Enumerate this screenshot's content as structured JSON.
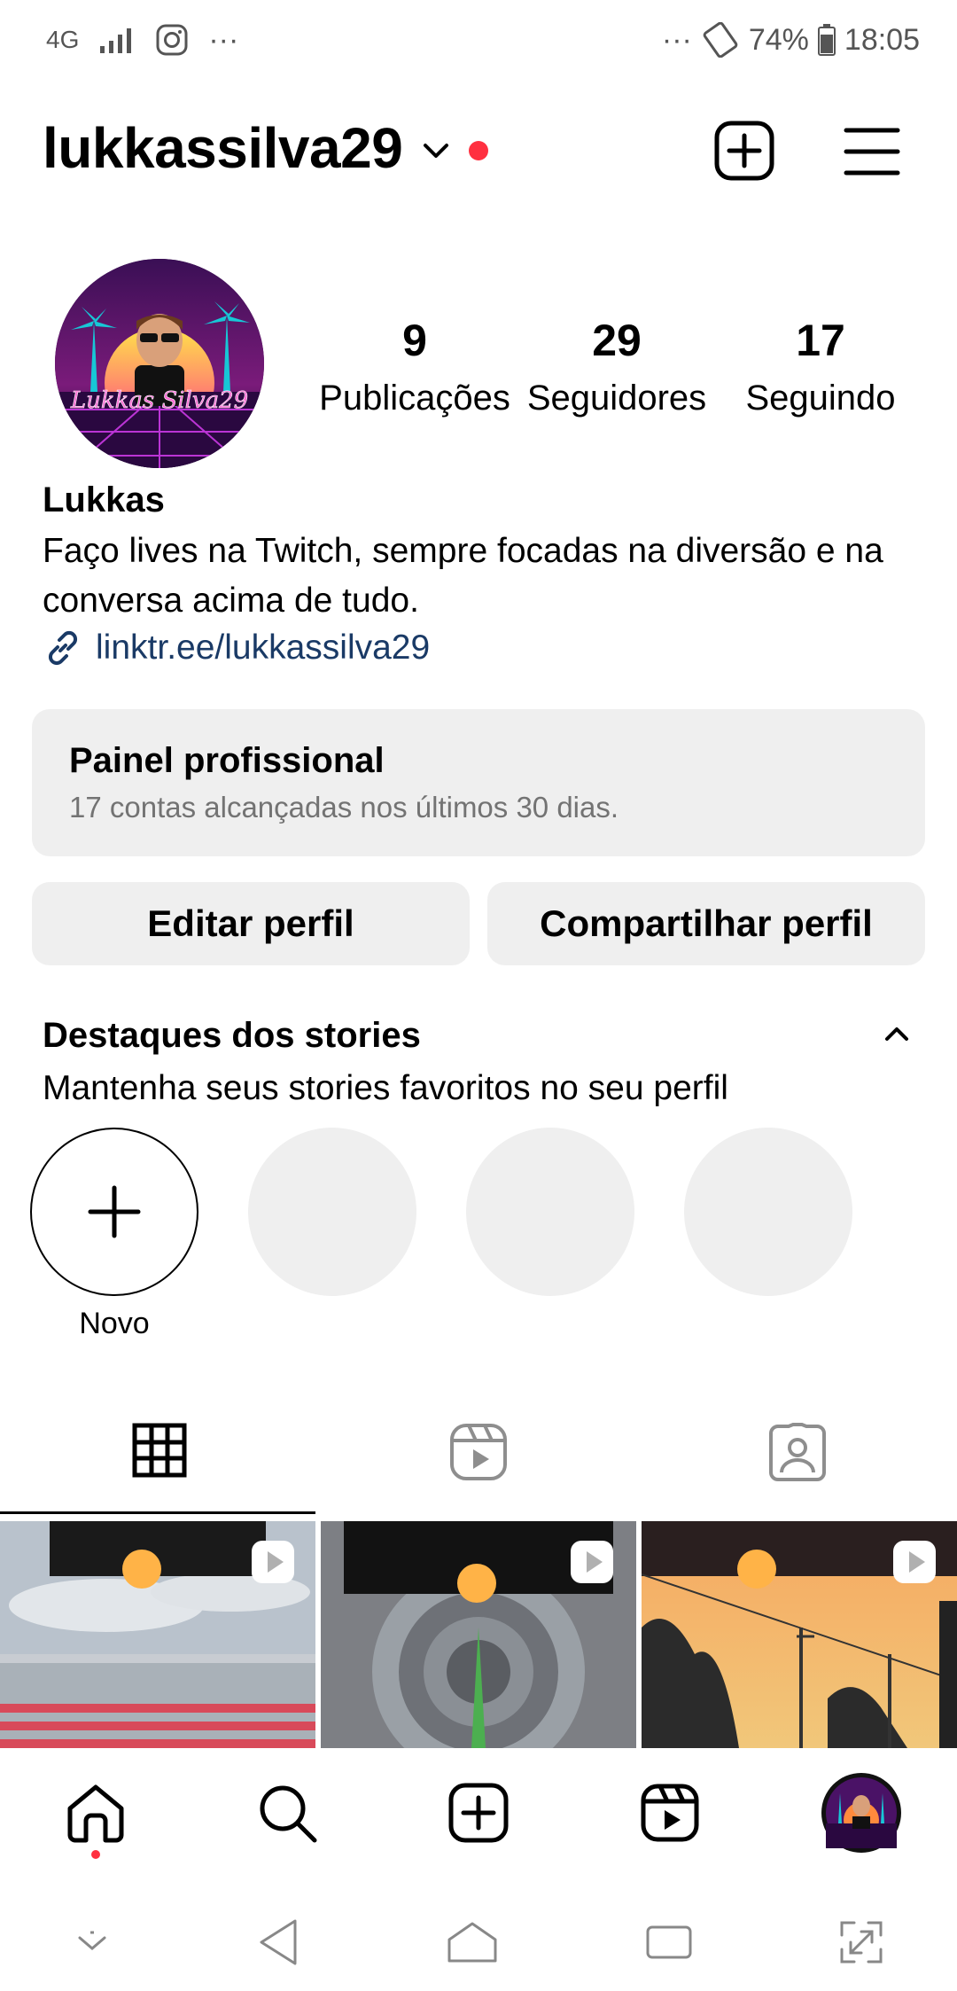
{
  "status_bar": {
    "network": "4G",
    "left_dots": "···",
    "right_dots": "···",
    "battery": "74%",
    "time": "18:05",
    "icons": [
      "signal-icon",
      "instagram-icon",
      "rotate-icon",
      "battery-icon"
    ]
  },
  "header": {
    "username": "lukkassilva29",
    "icons": [
      "chevron-down-icon",
      "notification-dot",
      "new-post-icon",
      "menu-icon"
    ]
  },
  "profile": {
    "avatar_text": "Lukkas Silva29",
    "stats": [
      {
        "value": "9",
        "label": "Publicações"
      },
      {
        "value": "29",
        "label": "Seguidores"
      },
      {
        "value": "17",
        "label": "Seguindo"
      }
    ],
    "name": "Lukkas",
    "bio": "Faço lives na Twitch, sempre focadas na diversão e na conversa acima de tudo.",
    "link": "linktr.ee/lukkassilva29"
  },
  "professional_panel": {
    "title": "Painel profissional",
    "subtitle": "17 contas alcançadas nos últimos 30 dias."
  },
  "buttons": {
    "edit": "Editar perfil",
    "share": "Compartilhar perfil"
  },
  "highlights": {
    "title": "Destaques dos stories",
    "subtitle": "Mantenha seus stories favoritos no seu perfil",
    "new_label": "Novo"
  },
  "tabs": [
    "grid-icon",
    "reels-icon",
    "tagged-icon"
  ],
  "bottom_nav": [
    "home-icon",
    "search-icon",
    "create-icon",
    "reels-icon",
    "profile-avatar"
  ],
  "system_nav": [
    "hide-icon",
    "back-icon",
    "home-icon",
    "recents-icon",
    "screenshot-icon"
  ],
  "colors": {
    "accent_red": "#ff3040",
    "link_blue": "#1a3a66",
    "panel_gray": "#efefef",
    "secondary_text": "#737373"
  }
}
